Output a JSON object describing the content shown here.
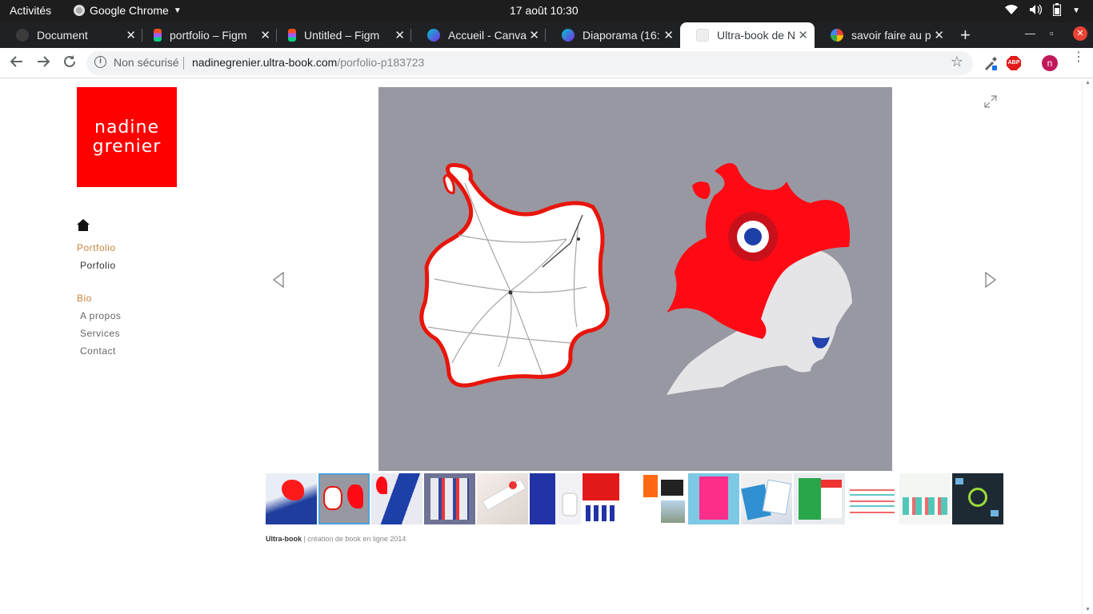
{
  "topbar": {
    "activities": "Activités",
    "app_name": "Google Chrome",
    "clock": "17 août  10:30"
  },
  "tabs": [
    {
      "title": "Document",
      "favicon_color": "#3c3c3c",
      "active": false
    },
    {
      "title": "portfolio – Figm",
      "favicon_color": "#f24e1e",
      "active": false
    },
    {
      "title": "Untitled – Figm",
      "favicon_color": "#f24e1e",
      "active": false
    },
    {
      "title": "Accueil - Canva",
      "favicon_color": "#7d2ae8",
      "active": false
    },
    {
      "title": "Diaporama (16:",
      "favicon_color": "#7d2ae8",
      "active": false
    },
    {
      "title": "Ultra-book de N",
      "favicon_color": "#e8eaed",
      "active": true
    },
    {
      "title": "savoir faire au p",
      "favicon_color": "#4285f4",
      "active": false
    }
  ],
  "toolbar": {
    "security": "Non sécurisé",
    "host": "nadinegrenier.ultra-book.com",
    "path": "/porfolio-p183723",
    "abp": "ABP",
    "avatar_letter": "n"
  },
  "site": {
    "logo_line1": "nadine",
    "logo_line2": "grenier",
    "menu": [
      {
        "heading": "Portfolio",
        "items": [
          "Porfolio"
        ]
      },
      {
        "heading": "Bio",
        "items": [
          "A propos",
          "Services",
          "Contact"
        ]
      }
    ]
  },
  "viewer": {
    "accent": "#ff0000",
    "background": "#9898a2",
    "selected_thumbnail": 2
  },
  "footer": {
    "brand": "Ultra-book",
    "text": " | création de book en ligne 2014"
  }
}
